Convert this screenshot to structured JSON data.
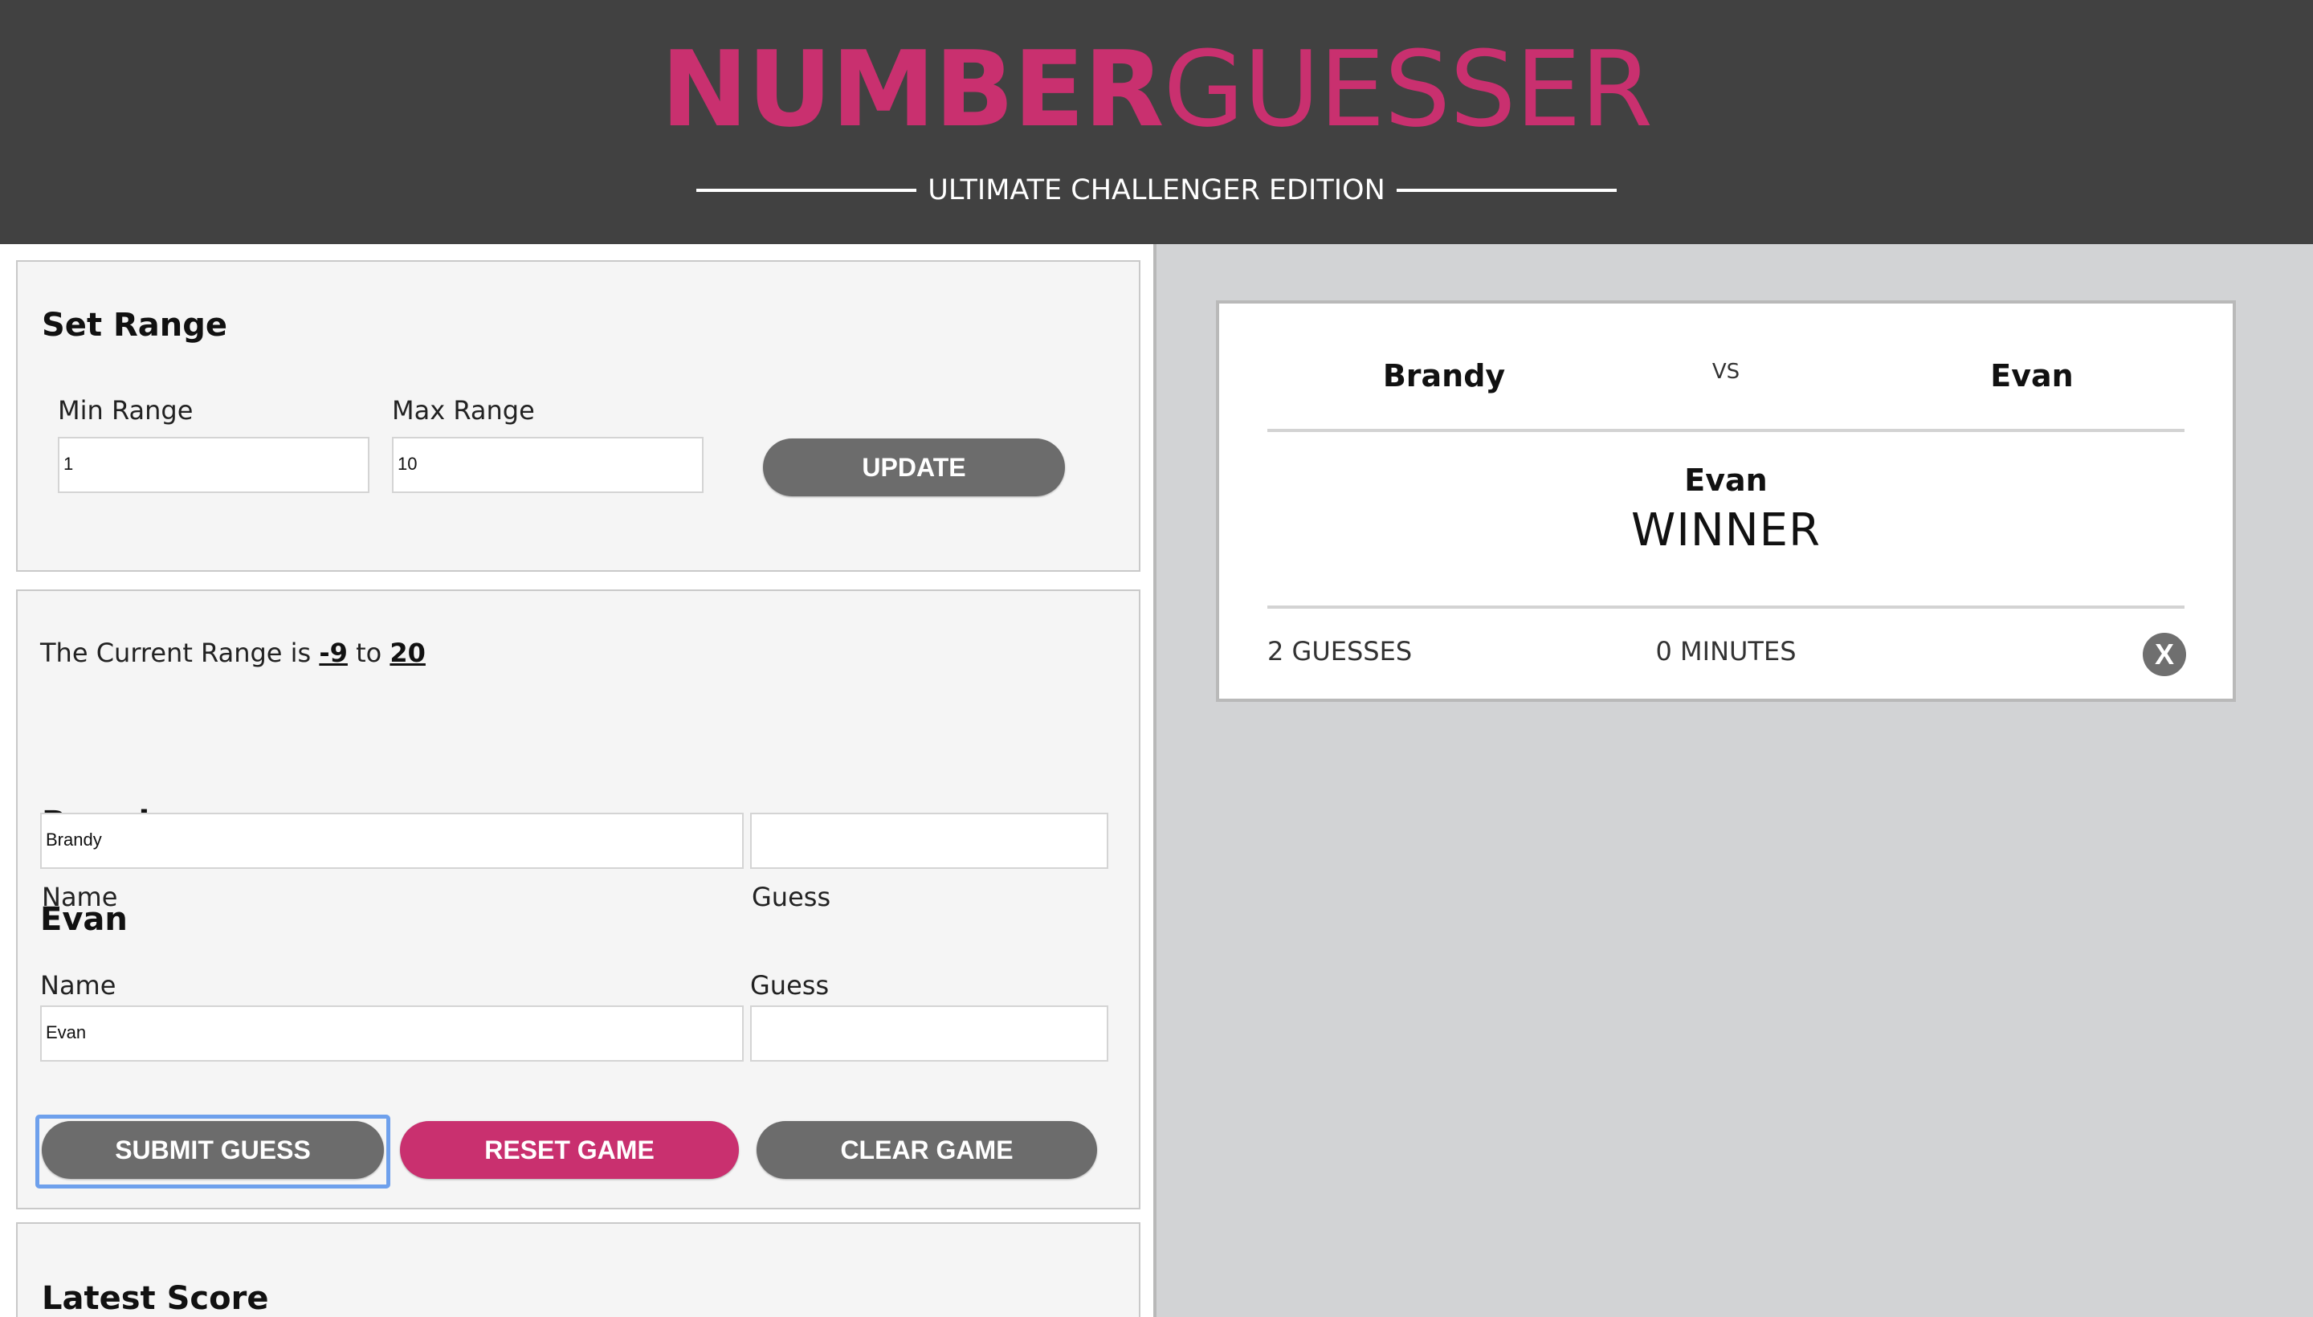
{
  "header": {
    "logo_bold": "NUMBER",
    "logo_light": "GUESSER",
    "subtitle": "ULTIMATE CHALLENGER EDITION"
  },
  "set_range": {
    "title": "Set Range",
    "min_label": "Min Range",
    "max_label": "Max Range",
    "min_value": "1",
    "max_value": "10",
    "update_label": "UPDATE"
  },
  "players": {
    "range_prefix": "The Current Range is",
    "range_min": "-9",
    "range_joiner": "to",
    "range_max": "20",
    "player1": {
      "heading": "Brandy",
      "name_label": "Name",
      "name_value": "Brandy",
      "guess_label": "Guess",
      "guess_value": ""
    },
    "player2": {
      "heading": "Evan",
      "name_label": "Name",
      "name_value": "Evan",
      "guess_label": "Guess",
      "guess_value": ""
    },
    "buttons": {
      "submit": "SUBMIT GUESS",
      "reset": "RESET GAME",
      "clear": "CLEAR GAME"
    }
  },
  "latest_score": {
    "title": "Latest Score"
  },
  "result_card": {
    "challenger1": "Brandy",
    "vs": "VS",
    "challenger2": "Evan",
    "winner_name": "Evan",
    "winner_label": "WINNER",
    "guesses": "2 GUESSES",
    "minutes": "0 MINUTES",
    "close": "X"
  },
  "colors": {
    "accent": "#c9306f",
    "header_bg": "#414141",
    "button_gray": "#6c6c6c",
    "page_bg": "#d2d3d5"
  }
}
